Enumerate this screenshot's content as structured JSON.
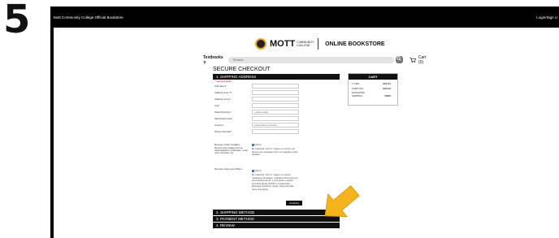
{
  "step": "5",
  "topbar": {
    "site": "Mott Community College Official Bookstore",
    "login": "Login/Sign U"
  },
  "logo": {
    "mott": "MOTT",
    "community_college": "COMMUNITY COLLEGE",
    "store": "ONLINE BOOKSTORE"
  },
  "nav": {
    "textbooks": "Textbooks ∨",
    "search_placeholder": "Search",
    "search_icon": "magnifier",
    "cart": "Cart (0)"
  },
  "checkout": {
    "title": "SECURE CHECKOUT",
    "section1": "1. SHIPPING ADDRESS",
    "required_note": "* required fields",
    "fields": [
      {
        "label": "Full Name*",
        "value": ""
      },
      {
        "label": "Address Line 1*",
        "value": ""
      },
      {
        "label": "Address Line 2",
        "value": ""
      },
      {
        "label": "City*",
        "value": ""
      },
      {
        "label": "State/Province*",
        "value": "- Select a State -"
      },
      {
        "label": "Zip/Postal Code*",
        "value": ""
      },
      {
        "label": "Country*",
        "value": "United States of America"
      },
      {
        "label": "Phone Number*",
        "value": ""
      }
    ],
    "order_updates_label": "Receive Order Updates",
    "order_updates_sub": "Receive order updates such as shipping/delivery confirmation, rental return reminders, etc.",
    "order_updates_check": "Opt in",
    "order_updates_desc": "By selecting \"Opt in\" I agree to receive cell phone text messages from us regarding order updates.",
    "news_label": "Receive News and Offers",
    "news_check": "Opt in",
    "news_desc": "By selecting \"Opt in\" I agree to receive marketing messages, including discounts and promotional events, to the phone number provided. Reply STOP to unsubscribe. Message frequency varies. Msg and data rates may apply.",
    "continue": "Continue",
    "section2": "2. SHIPPING METHOD",
    "section3": "3. PAYMENT METHOD",
    "section4": "4. REVIEW"
  },
  "cart": {
    "header": "CART",
    "rows": [
      {
        "label": "1 ITEM",
        "value": "$XX.XX"
      },
      {
        "label": "SUBTOTAL",
        "value": "$XX.XX"
      },
      {
        "label": "ESTIMATED",
        "value": ""
      },
      {
        "label": "SHIPPING",
        "value": "FREE"
      }
    ]
  },
  "colors": {
    "arrow": "#f5b41e",
    "bar": "#111111",
    "checkbox": "#3a6fd8"
  }
}
